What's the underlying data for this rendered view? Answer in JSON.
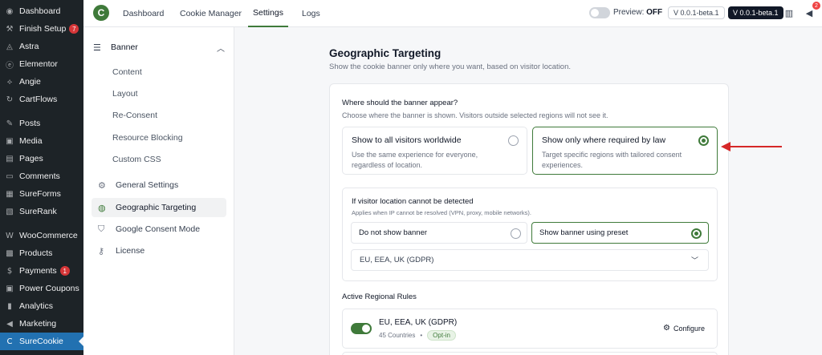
{
  "wp_sidebar": {
    "items": [
      {
        "label": "Dashboard",
        "icon": "dashboard-icon",
        "glyph": "◉"
      },
      {
        "label": "Finish Setup",
        "icon": "hammer-icon",
        "glyph": "⚒",
        "badge": "7"
      },
      {
        "label": "Astra",
        "icon": "astra-icon",
        "glyph": "◬"
      },
      {
        "label": "Elementor",
        "icon": "elementor-icon",
        "glyph": "ⓔ"
      },
      {
        "label": "Angie",
        "icon": "angie-icon",
        "glyph": "⟡"
      },
      {
        "label": "CartFlows",
        "icon": "cartflows-icon",
        "glyph": "↻"
      },
      {
        "label": "Posts",
        "icon": "pin-icon",
        "glyph": "✎"
      },
      {
        "label": "Media",
        "icon": "media-icon",
        "glyph": "▣"
      },
      {
        "label": "Pages",
        "icon": "pages-icon",
        "glyph": "▤"
      },
      {
        "label": "Comments",
        "icon": "comment-icon",
        "glyph": "▭"
      },
      {
        "label": "SureForms",
        "icon": "sureforms-icon",
        "glyph": "▦"
      },
      {
        "label": "SureRank",
        "icon": "surerank-icon",
        "glyph": "▧"
      },
      {
        "label": "WooCommerce",
        "icon": "woocommerce-icon",
        "glyph": "W"
      },
      {
        "label": "Products",
        "icon": "products-icon",
        "glyph": "▩"
      },
      {
        "label": "Payments",
        "icon": "payments-icon",
        "glyph": "$",
        "badge": "1"
      },
      {
        "label": "Power Coupons",
        "icon": "coupons-icon",
        "glyph": "▣"
      },
      {
        "label": "Analytics",
        "icon": "analytics-icon",
        "glyph": "▮"
      },
      {
        "label": "Marketing",
        "icon": "megaphone-icon",
        "glyph": "◀"
      },
      {
        "label": "SureCookie",
        "icon": "surecookie-icon",
        "glyph": "C",
        "active": true
      }
    ]
  },
  "topbar": {
    "logo_letter": "C",
    "tabs": [
      "Dashboard",
      "Cookie Manager",
      "Settings",
      "Logs"
    ],
    "active_tab": "Settings",
    "preview_label": "Preview:",
    "preview_state": "OFF",
    "version_outline": "V 0.0.1-beta.1",
    "version_dark": "V 0.0.1-beta.1",
    "notification_count": "2"
  },
  "settings_nav": {
    "group_label": "Banner",
    "sub_items": [
      "Content",
      "Layout",
      "Re-Consent",
      "Resource Blocking",
      "Custom CSS"
    ],
    "items": [
      {
        "label": "General Settings",
        "icon": "gear-icon"
      },
      {
        "label": "Geographic Targeting",
        "icon": "globe-icon",
        "active": true
      },
      {
        "label": "Google Consent Mode",
        "icon": "shield-icon"
      },
      {
        "label": "License",
        "icon": "key-icon"
      }
    ]
  },
  "main": {
    "title": "Geographic Targeting",
    "description": "Show the cookie banner only where you want, based on visitor location.",
    "question": "Where should the banner appear?",
    "question_desc": "Choose where the banner is shown. Visitors outside selected regions will not see it.",
    "options": [
      {
        "title": "Show to all visitors worldwide",
        "desc": "Use the same experience for everyone, regardless of location.",
        "selected": false
      },
      {
        "title": "Show only where required by law",
        "desc": "Target specific regions with tailored consent experiences.",
        "selected": true
      }
    ],
    "fallback": {
      "title": "If visitor location cannot be detected",
      "desc": "Applies when IP cannot be resolved (VPN, proxy, mobile networks).",
      "options": [
        {
          "label": "Do not show banner",
          "selected": false
        },
        {
          "label": "Show banner using preset",
          "selected": true
        }
      ],
      "preset_value": "EU, EEA, UK (GDPR)"
    },
    "rules_title": "Active Regional Rules",
    "rules": [
      {
        "name": "EU, EEA, UK (GDPR)",
        "countries": "45 Countries",
        "separator": "•",
        "mode": "Opt-in",
        "enabled": true,
        "action": "Configure"
      }
    ]
  },
  "colors": {
    "accent": "#3f7a3a",
    "wp_sidebar": "#1d2327",
    "wp_active": "#2271b1",
    "annotation_arrow": "#d62828"
  }
}
